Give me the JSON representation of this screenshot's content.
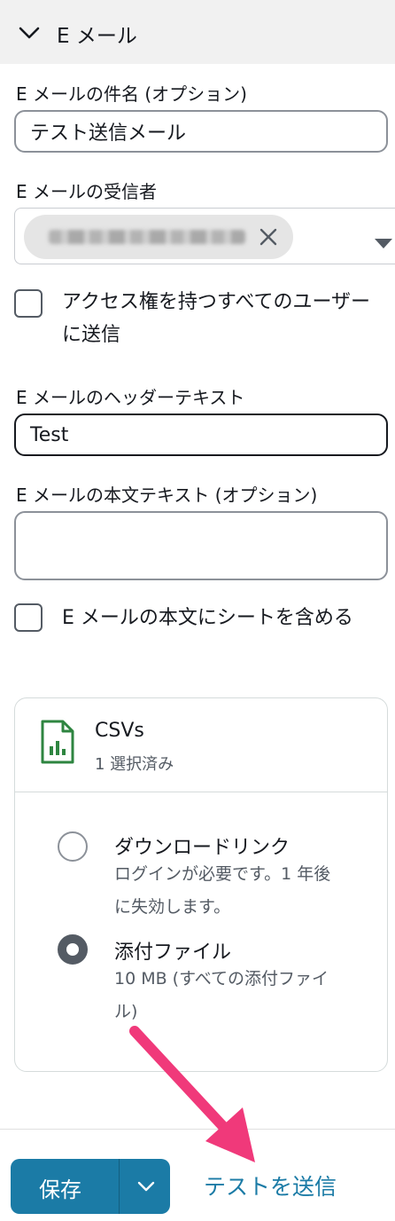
{
  "section": {
    "title": "E メール",
    "expanded": true
  },
  "subject": {
    "label": "E メールの件名 (オプション)",
    "value": "テスト送信メール"
  },
  "recipients": {
    "label": "E メールの受信者"
  },
  "all_users": {
    "label": "アクセス権を持つすべてのユーザーに送信",
    "checked": false
  },
  "header_text": {
    "label": "E メールのヘッダーテキスト",
    "value": "Test"
  },
  "body_text": {
    "label": "E メールの本文テキスト (オプション)",
    "value": ""
  },
  "include_sheet": {
    "label": "E メールの本文にシートを含める",
    "checked": false
  },
  "attachment_card": {
    "title": "CSVs",
    "subtitle": "1 選択済み",
    "options": [
      {
        "label": "ダウンロードリンク",
        "description": "ログインが必要です。1 年後に失効します。",
        "selected": false
      },
      {
        "label": "添付ファイル",
        "description": "10 MB (すべての添付ファイル)",
        "selected": true
      }
    ]
  },
  "footer": {
    "save_label": "保存",
    "test_send_label": "テストを送信"
  },
  "colors": {
    "primary": "#1b7ba6",
    "annotation_arrow": "#f0397a",
    "header_bg": "#f1f1f1"
  }
}
